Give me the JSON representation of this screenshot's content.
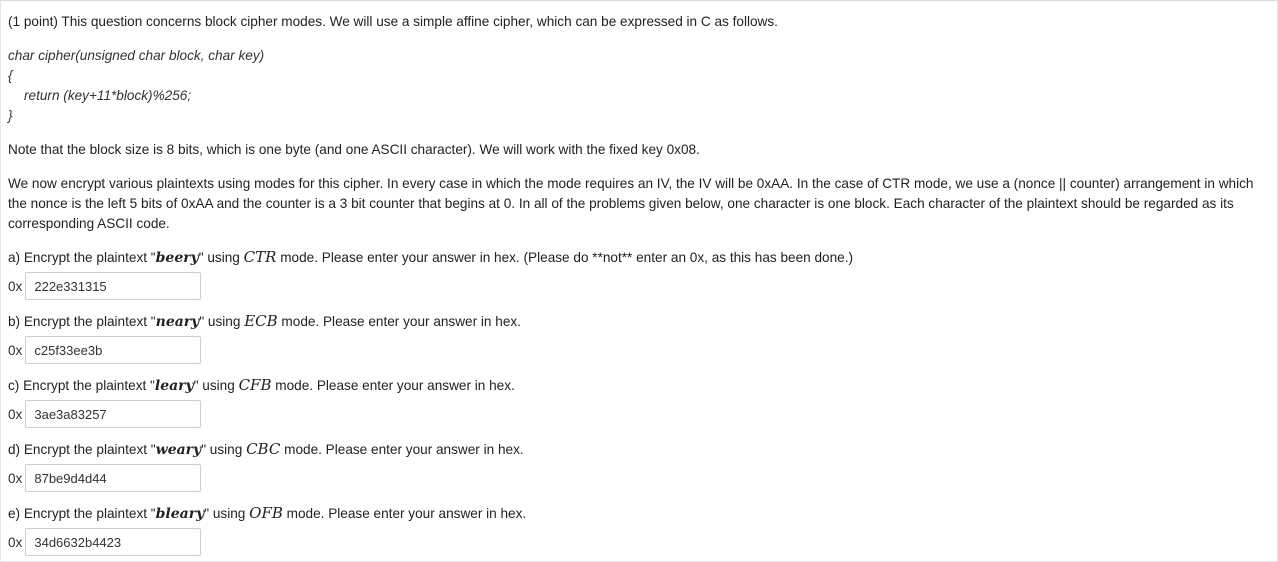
{
  "intro": "(1 point) This question concerns block cipher modes. We will use a simple affine cipher, which can be expressed in C as follows.",
  "code": {
    "line1": "char cipher(unsigned char block, char key)",
    "line2": "{",
    "line3": "return (key+11*block)%256;",
    "line4": "}"
  },
  "note": "Note that the block size is 8 bits, which is one byte (and one ASCII character). We will work with the fixed key 0x08.",
  "description": "We now encrypt various plaintexts using modes for this cipher. In every case in which the mode requires an IV, the IV will be 0xAA. In the case of CTR mode, we use a (nonce || counter) arrangement in which the nonce is the left 5 bits of 0xAA and the counter is a 3 bit counter that begins at 0. In all of the problems given below, one character is one block. Each character of the plaintext should be regarded as its corresponding ASCII code.",
  "answer_prefix": "0x",
  "questions": [
    {
      "pre": "a) Encrypt the plaintext \"",
      "word": "beery",
      "mid": "\" using ",
      "mode": "CTR",
      "post": " mode. Please enter your answer in hex. (Please do **not** enter an 0x, as this has been done.)",
      "answer": "222e331315"
    },
    {
      "pre": "b) Encrypt the plaintext \"",
      "word": "neary",
      "mid": "\" using ",
      "mode": "ECB",
      "post": " mode. Please enter your answer in hex.",
      "answer": "c25f33ee3b"
    },
    {
      "pre": "c) Encrypt the plaintext \"",
      "word": "leary",
      "mid": "\" using ",
      "mode": "CFB",
      "post": " mode. Please enter your answer in hex.",
      "answer": "3ae3a83257"
    },
    {
      "pre": "d) Encrypt the plaintext \"",
      "word": "weary",
      "mid": "\" using ",
      "mode": "CBC",
      "post": " mode. Please enter your answer in hex.",
      "answer": "87be9d4d44"
    },
    {
      "pre": "e) Encrypt the plaintext \"",
      "word": "bleary",
      "mid": "\" using ",
      "mode": "OFB",
      "post": " mode. Please enter your answer in hex.",
      "answer": "34d6632b4423"
    }
  ]
}
